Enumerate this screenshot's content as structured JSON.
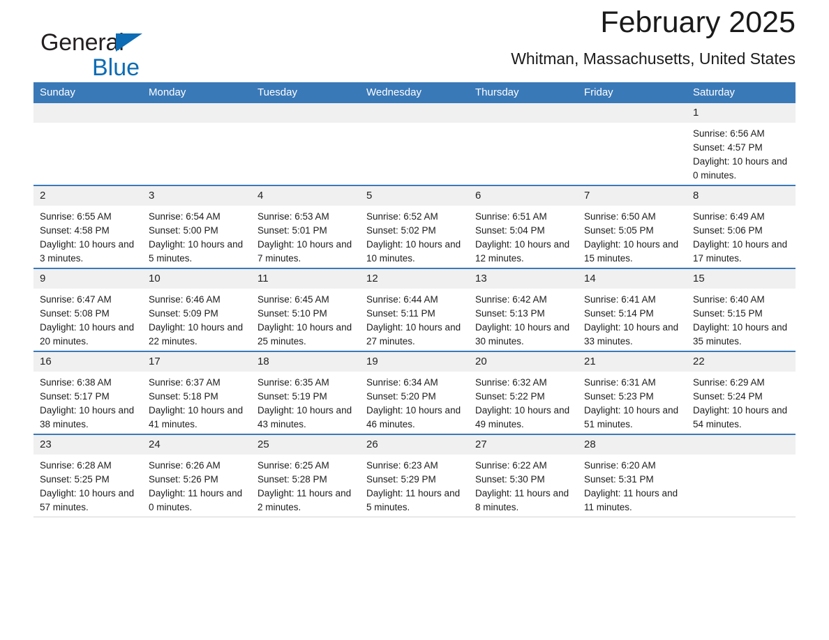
{
  "brand": {
    "name_part1": "General",
    "name_part2": "Blue",
    "accent_color": "#0d6cb4"
  },
  "header": {
    "title": "February 2025",
    "subtitle": "Whitman, Massachusetts, United States"
  },
  "theme": {
    "header_bar_color": "#3a79b8",
    "daynum_band_color": "#f0f0f0",
    "week_divider_color": "#3a79b8"
  },
  "calendar": {
    "weekday_headers": [
      "Sunday",
      "Monday",
      "Tuesday",
      "Wednesday",
      "Thursday",
      "Friday",
      "Saturday"
    ],
    "weeks": [
      [
        {
          "day": "",
          "empty": true
        },
        {
          "day": "",
          "empty": true
        },
        {
          "day": "",
          "empty": true
        },
        {
          "day": "",
          "empty": true
        },
        {
          "day": "",
          "empty": true
        },
        {
          "day": "",
          "empty": true
        },
        {
          "day": "1",
          "sunrise": "Sunrise: 6:56 AM",
          "sunset": "Sunset: 4:57 PM",
          "daylight": "Daylight: 10 hours and 0 minutes."
        }
      ],
      [
        {
          "day": "2",
          "sunrise": "Sunrise: 6:55 AM",
          "sunset": "Sunset: 4:58 PM",
          "daylight": "Daylight: 10 hours and 3 minutes."
        },
        {
          "day": "3",
          "sunrise": "Sunrise: 6:54 AM",
          "sunset": "Sunset: 5:00 PM",
          "daylight": "Daylight: 10 hours and 5 minutes."
        },
        {
          "day": "4",
          "sunrise": "Sunrise: 6:53 AM",
          "sunset": "Sunset: 5:01 PM",
          "daylight": "Daylight: 10 hours and 7 minutes."
        },
        {
          "day": "5",
          "sunrise": "Sunrise: 6:52 AM",
          "sunset": "Sunset: 5:02 PM",
          "daylight": "Daylight: 10 hours and 10 minutes."
        },
        {
          "day": "6",
          "sunrise": "Sunrise: 6:51 AM",
          "sunset": "Sunset: 5:04 PM",
          "daylight": "Daylight: 10 hours and 12 minutes."
        },
        {
          "day": "7",
          "sunrise": "Sunrise: 6:50 AM",
          "sunset": "Sunset: 5:05 PM",
          "daylight": "Daylight: 10 hours and 15 minutes."
        },
        {
          "day": "8",
          "sunrise": "Sunrise: 6:49 AM",
          "sunset": "Sunset: 5:06 PM",
          "daylight": "Daylight: 10 hours and 17 minutes."
        }
      ],
      [
        {
          "day": "9",
          "sunrise": "Sunrise: 6:47 AM",
          "sunset": "Sunset: 5:08 PM",
          "daylight": "Daylight: 10 hours and 20 minutes."
        },
        {
          "day": "10",
          "sunrise": "Sunrise: 6:46 AM",
          "sunset": "Sunset: 5:09 PM",
          "daylight": "Daylight: 10 hours and 22 minutes."
        },
        {
          "day": "11",
          "sunrise": "Sunrise: 6:45 AM",
          "sunset": "Sunset: 5:10 PM",
          "daylight": "Daylight: 10 hours and 25 minutes."
        },
        {
          "day": "12",
          "sunrise": "Sunrise: 6:44 AM",
          "sunset": "Sunset: 5:11 PM",
          "daylight": "Daylight: 10 hours and 27 minutes."
        },
        {
          "day": "13",
          "sunrise": "Sunrise: 6:42 AM",
          "sunset": "Sunset: 5:13 PM",
          "daylight": "Daylight: 10 hours and 30 minutes."
        },
        {
          "day": "14",
          "sunrise": "Sunrise: 6:41 AM",
          "sunset": "Sunset: 5:14 PM",
          "daylight": "Daylight: 10 hours and 33 minutes."
        },
        {
          "day": "15",
          "sunrise": "Sunrise: 6:40 AM",
          "sunset": "Sunset: 5:15 PM",
          "daylight": "Daylight: 10 hours and 35 minutes."
        }
      ],
      [
        {
          "day": "16",
          "sunrise": "Sunrise: 6:38 AM",
          "sunset": "Sunset: 5:17 PM",
          "daylight": "Daylight: 10 hours and 38 minutes."
        },
        {
          "day": "17",
          "sunrise": "Sunrise: 6:37 AM",
          "sunset": "Sunset: 5:18 PM",
          "daylight": "Daylight: 10 hours and 41 minutes."
        },
        {
          "day": "18",
          "sunrise": "Sunrise: 6:35 AM",
          "sunset": "Sunset: 5:19 PM",
          "daylight": "Daylight: 10 hours and 43 minutes."
        },
        {
          "day": "19",
          "sunrise": "Sunrise: 6:34 AM",
          "sunset": "Sunset: 5:20 PM",
          "daylight": "Daylight: 10 hours and 46 minutes."
        },
        {
          "day": "20",
          "sunrise": "Sunrise: 6:32 AM",
          "sunset": "Sunset: 5:22 PM",
          "daylight": "Daylight: 10 hours and 49 minutes."
        },
        {
          "day": "21",
          "sunrise": "Sunrise: 6:31 AM",
          "sunset": "Sunset: 5:23 PM",
          "daylight": "Daylight: 10 hours and 51 minutes."
        },
        {
          "day": "22",
          "sunrise": "Sunrise: 6:29 AM",
          "sunset": "Sunset: 5:24 PM",
          "daylight": "Daylight: 10 hours and 54 minutes."
        }
      ],
      [
        {
          "day": "23",
          "sunrise": "Sunrise: 6:28 AM",
          "sunset": "Sunset: 5:25 PM",
          "daylight": "Daylight: 10 hours and 57 minutes."
        },
        {
          "day": "24",
          "sunrise": "Sunrise: 6:26 AM",
          "sunset": "Sunset: 5:26 PM",
          "daylight": "Daylight: 11 hours and 0 minutes."
        },
        {
          "day": "25",
          "sunrise": "Sunrise: 6:25 AM",
          "sunset": "Sunset: 5:28 PM",
          "daylight": "Daylight: 11 hours and 2 minutes."
        },
        {
          "day": "26",
          "sunrise": "Sunrise: 6:23 AM",
          "sunset": "Sunset: 5:29 PM",
          "daylight": "Daylight: 11 hours and 5 minutes."
        },
        {
          "day": "27",
          "sunrise": "Sunrise: 6:22 AM",
          "sunset": "Sunset: 5:30 PM",
          "daylight": "Daylight: 11 hours and 8 minutes."
        },
        {
          "day": "28",
          "sunrise": "Sunrise: 6:20 AM",
          "sunset": "Sunset: 5:31 PM",
          "daylight": "Daylight: 11 hours and 11 minutes."
        },
        {
          "day": "",
          "empty": true
        }
      ]
    ]
  }
}
